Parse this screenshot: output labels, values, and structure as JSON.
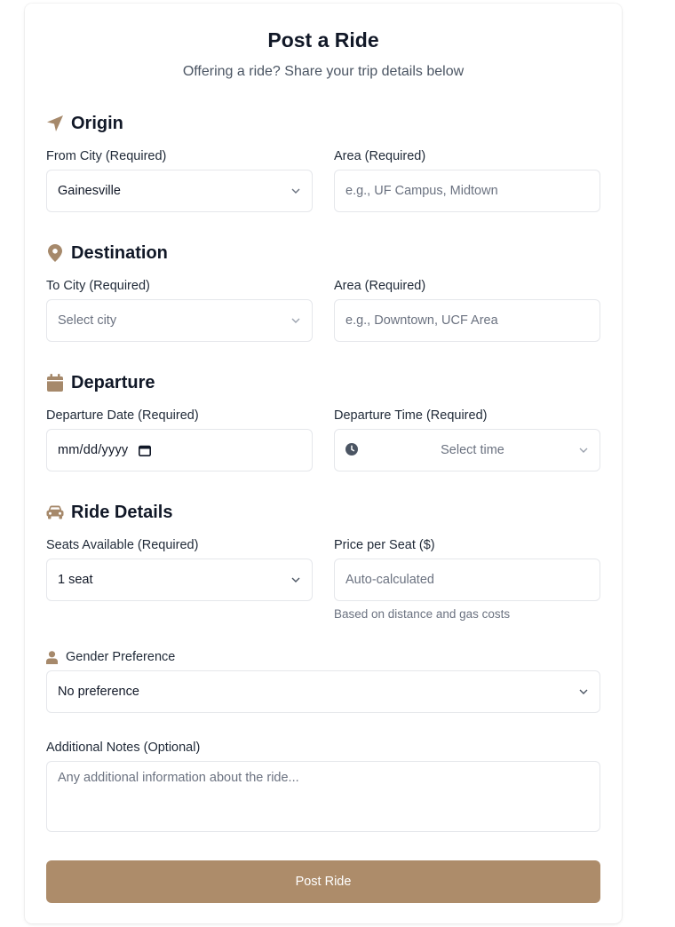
{
  "header": {
    "title": "Post a Ride",
    "subtitle": "Offering a ride? Share your trip details below"
  },
  "colors": {
    "accent": "#ad8c6a",
    "icon": "#a6896b",
    "border": "#e5e7eb"
  },
  "origin": {
    "heading": "Origin",
    "icon": "location-arrow-icon",
    "city_label": "From City (Required)",
    "city_value": "Gainesville",
    "area_label": "Area (Required)",
    "area_placeholder": "e.g., UF Campus, Midtown"
  },
  "destination": {
    "heading": "Destination",
    "icon": "map-pin-icon",
    "city_label": "To City (Required)",
    "city_placeholder": "Select city",
    "area_label": "Area (Required)",
    "area_placeholder": "e.g., Downtown, UCF Area"
  },
  "departure": {
    "heading": "Departure",
    "icon": "calendar-icon",
    "date_label": "Departure Date (Required)",
    "date_value": "mm/dd/yyyy",
    "time_label": "Departure Time (Required)",
    "time_placeholder": "Select time"
  },
  "ride_details": {
    "heading": "Ride Details",
    "icon": "car-icon",
    "seats_label": "Seats Available (Required)",
    "seats_value": "1 seat",
    "price_label": "Price per Seat ($)",
    "price_placeholder": "Auto-calculated",
    "price_hint": "Based on distance and gas costs"
  },
  "gender": {
    "label": "Gender Preference",
    "icon": "user-icon",
    "value": "No preference"
  },
  "notes": {
    "label": "Additional Notes (Optional)",
    "placeholder": "Any additional information about the ride..."
  },
  "submit": {
    "label": "Post Ride"
  }
}
